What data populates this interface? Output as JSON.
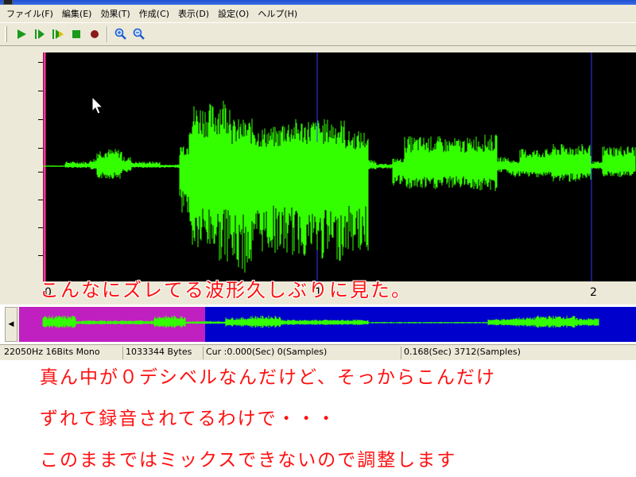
{
  "window": {
    "title": ""
  },
  "menu": {
    "items": [
      "ファイル(F)",
      "編集(E)",
      "効果(T)",
      "作成(C)",
      "表示(D)",
      "設定(O)",
      "ヘルプ(H)"
    ]
  },
  "toolbar": {
    "buttons": [
      "play-icon",
      "play-selection-icon",
      "play-loop-icon",
      "stop-icon",
      "record-icon",
      "zoom-in-icon",
      "zoom-out-icon"
    ],
    "colors": {
      "play": "#1a9a1a",
      "stop": "#1a9a1a",
      "record": "#8b1a1a",
      "zoom": "#1a5ad0"
    }
  },
  "waveform": {
    "background": "#000000",
    "wave_color": "#33ff00",
    "marker_color": "#3333ff",
    "cursor_color": "#ff3399",
    "time_labels": [
      "0",
      "1",
      "2"
    ]
  },
  "overview": {
    "selection_color": "#c020c0",
    "background": "#0000cc",
    "wave_color": "#33ff00"
  },
  "status": {
    "format": "22050Hz 16Bits Mono",
    "size": "1033344 Bytes",
    "cursor": "Cur :0.000(Sec) 0(Samples)",
    "selection": "0.168(Sec) 3712(Samples)"
  },
  "annotations": {
    "top": "こんなにズレてる波形久しぶりに見た。",
    "line1": "真ん中が０デシベルなんだけど、そっからこんだけ",
    "line2": "ずれて録音されてるわけで・・・",
    "line3": "このままではミックスできないので調整します"
  }
}
